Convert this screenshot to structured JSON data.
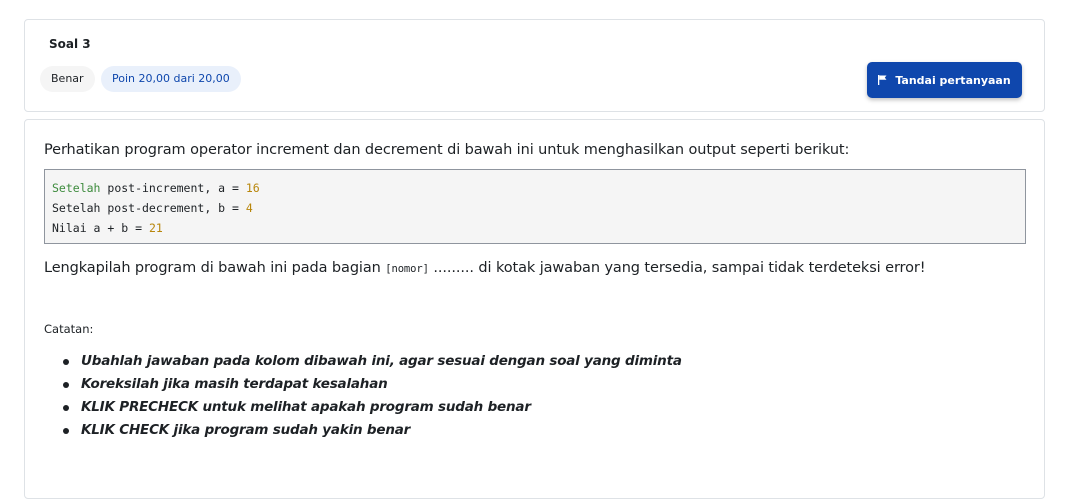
{
  "question": {
    "title": "Soal 3",
    "state": "Benar",
    "grade": "Poin 20,00 dari 20,00",
    "flag_label": "Tandai pertanyaan"
  },
  "content": {
    "intro": "Perhatikan program operator increment dan decrement di bawah ini untuk menghasilkan output seperti berikut:",
    "code": [
      {
        "kw": "Setelah",
        "text": " post-increment, a = ",
        "num": "16"
      },
      {
        "kw": "",
        "text": "Setelah post-decrement, b = ",
        "num": "4"
      },
      {
        "kw": "",
        "text": "Nilai a + b = ",
        "num": "21"
      }
    ],
    "instruction_before": "Lengkapilah program di bawah ini pada bagian ",
    "instruction_code": "[nomor]",
    "instruction_dots": " ......... ",
    "instruction_after": " di kotak jawaban yang tersedia, sampai tidak terdeteksi error!",
    "note_label": "Catatan:",
    "notes": [
      "Ubahlah jawaban pada kolom dibawah ini, agar sesuai dengan soal yang diminta",
      "Koreksilah jika masih terdapat kesalahan",
      "KLIK PRECHECK untuk melihat apakah program sudah benar",
      "KLIK CHECK jika program sudah yakin benar"
    ]
  },
  "colors": {
    "primary": "#0f47ad",
    "grade_badge_bg": "#e9f0fb",
    "code_keyword": "#3d8b3d",
    "code_number": "#b8860b"
  },
  "icons": {
    "flag": "flag-icon"
  }
}
